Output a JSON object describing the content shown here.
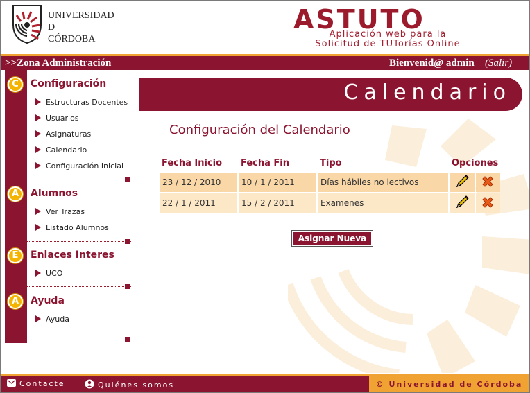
{
  "header": {
    "university_lines": [
      "UNIVERSIDAD",
      "D",
      "CÓRDOBA"
    ],
    "app_name": "ASTUTO",
    "app_subtitle_line1": "Aplicación web para la",
    "app_subtitle_line2": "Solicitud de TUTorías Online"
  },
  "topbar": {
    "zone": ">>Zona Administración",
    "welcome": "Bienvenid@ admin",
    "logout": "(Salir)"
  },
  "sidebar": {
    "sections": [
      {
        "badge": "C",
        "title": "Configuración",
        "items": [
          "Estructuras Docentes",
          "Usuarios",
          "Asignaturas",
          "Calendario",
          "Configuración Inicial"
        ]
      },
      {
        "badge": "A",
        "title": "Alumnos",
        "items": [
          "Ver Trazas",
          "Listado Alumnos"
        ]
      },
      {
        "badge": "E",
        "title": "Enlaces Interes",
        "items": [
          "UCO"
        ]
      },
      {
        "badge": "A",
        "title": "Ayuda",
        "items": [
          "Ayuda"
        ]
      }
    ]
  },
  "main": {
    "banner_title": "Calendario",
    "section_title": "Configuración del Calendario",
    "table": {
      "headers": [
        "Fecha Inicio",
        "Fecha Fin",
        "Tipo",
        "Opciones"
      ],
      "rows": [
        {
          "start": "23 / 12 / 2010",
          "end": "10 / 1 / 2011",
          "type": "Días hábiles no lectivos"
        },
        {
          "start": "22 / 1 / 2011",
          "end": "15 / 2 / 2011",
          "type": "Examenes"
        }
      ]
    },
    "new_button": "Asignar Nueva"
  },
  "footer": {
    "contact": "Contacte",
    "about": "Quiénes somos",
    "copyright": "© Universidad de Córdoba"
  },
  "colors": {
    "primary": "#8b1530",
    "accent": "#f0a232",
    "row_odd": "#f9d7a6",
    "row_even": "#fce7c7"
  },
  "icons": {
    "edit": "pencil-icon",
    "delete": "cross-icon",
    "contact": "mail-icon",
    "about": "person-icon"
  }
}
